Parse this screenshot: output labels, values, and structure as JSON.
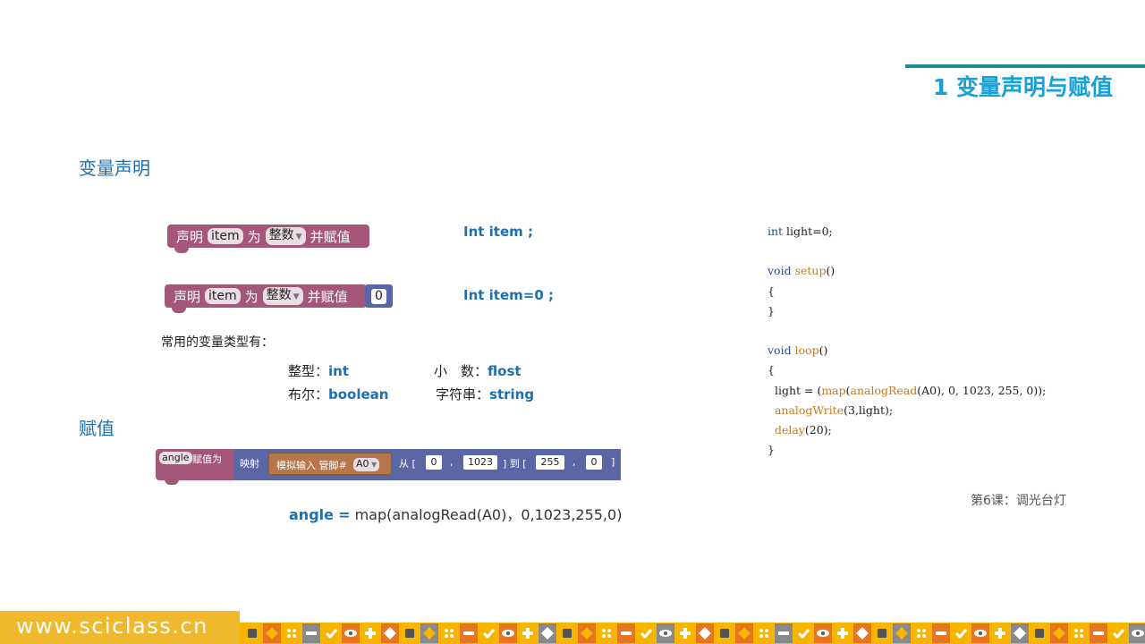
{
  "header": {
    "title": "1 变量声明与赋值"
  },
  "sections": {
    "declare": "变量声明",
    "assign": "赋值"
  },
  "declare_blocks": [
    {
      "kw_declare": "声明",
      "var": "item",
      "kw_as": "为",
      "type": "整数",
      "kw_assign": "并赋值",
      "value": "",
      "code": "Int item ;"
    },
    {
      "kw_declare": "声明",
      "var": "item",
      "kw_as": "为",
      "type": "整数",
      "kw_assign": "并赋值",
      "value": "0",
      "code": "Int item=0 ;"
    }
  ],
  "types": {
    "heading": "常用的变量类型有：",
    "items": [
      {
        "label": "整型：",
        "value": "int"
      },
      {
        "label": "小　数：",
        "value": "flost"
      },
      {
        "label": "布尔：",
        "value": "boolean"
      },
      {
        "label": "字符串：",
        "value": "string"
      }
    ]
  },
  "assign_block": {
    "var": "angle",
    "kw_assign": "赋值为",
    "kw_map": "映射",
    "sensor_label": "模拟输入 管脚#",
    "pin": "A0",
    "kw_from": "从 [",
    "from_low": "0",
    "comma1": ",",
    "from_high": "1023",
    "kw_to": "] 到 [",
    "to_low": "255",
    "comma2": ",",
    "to_high": "0",
    "close": "]"
  },
  "formula": {
    "var": "angle",
    "eq": "=",
    "expr": "map(analogRead(A0)，0,1023,255,0)"
  },
  "code_lines": [
    [
      {
        "t": "int",
        "c": "kw"
      },
      {
        "t": " light=0;",
        "c": ""
      }
    ],
    [],
    [
      {
        "t": "void",
        "c": "kw"
      },
      {
        "t": " ",
        "c": ""
      },
      {
        "t": "setup",
        "c": "fn"
      },
      {
        "t": "()",
        "c": ""
      }
    ],
    [
      {
        "t": "{",
        "c": ""
      }
    ],
    [
      {
        "t": "}",
        "c": ""
      }
    ],
    [],
    [
      {
        "t": "void",
        "c": "kw"
      },
      {
        "t": " ",
        "c": ""
      },
      {
        "t": "loop",
        "c": "fn"
      },
      {
        "t": "()",
        "c": ""
      }
    ],
    [
      {
        "t": "{",
        "c": ""
      }
    ],
    [
      {
        "t": "  light = (",
        "c": ""
      },
      {
        "t": "map",
        "c": "fn"
      },
      {
        "t": "(",
        "c": ""
      },
      {
        "t": "analogRead",
        "c": "fn"
      },
      {
        "t": "(A0), 0, 1023, 255, 0));",
        "c": ""
      }
    ],
    [
      {
        "t": "  ",
        "c": ""
      },
      {
        "t": "analogWrite",
        "c": "fn"
      },
      {
        "t": "(3,light);",
        "c": ""
      }
    ],
    [
      {
        "t": "  ",
        "c": ""
      },
      {
        "t": "delay",
        "c": "fn"
      },
      {
        "t": "(20);",
        "c": ""
      }
    ],
    [
      {
        "t": "}",
        "c": ""
      }
    ]
  ],
  "lesson": "第6课：调光台灯",
  "footer": {
    "url": "www.sciclass.cn"
  },
  "colors": {
    "accent": "#19a0d8",
    "block_pink": "#a5577a",
    "block_blue": "#5b67a5",
    "footer_yellow": "#f0b82c"
  }
}
